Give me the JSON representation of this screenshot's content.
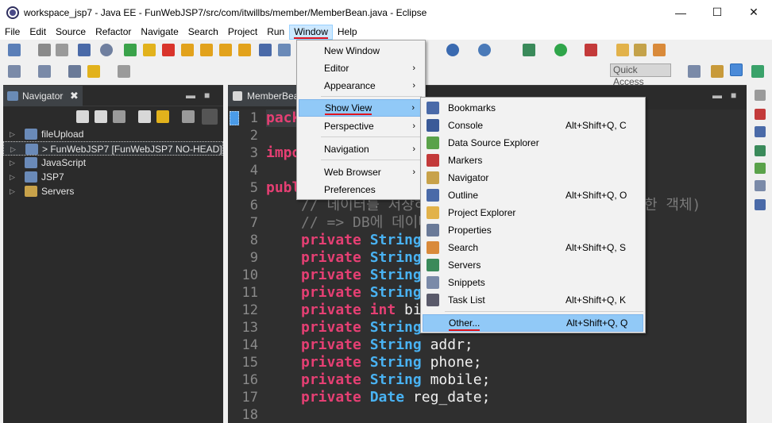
{
  "window": {
    "title": "workspace_jsp7 - Java EE - FunWebJSP7/src/com/itwillbs/member/MemberBean.java - Eclipse",
    "minimize": "—",
    "maximize": "☐",
    "close": "✕"
  },
  "menubar": [
    {
      "label": "File"
    },
    {
      "label": "Edit"
    },
    {
      "label": "Source"
    },
    {
      "label": "Refactor"
    },
    {
      "label": "Navigate"
    },
    {
      "label": "Search"
    },
    {
      "label": "Project"
    },
    {
      "label": "Run"
    },
    {
      "label": "Window"
    },
    {
      "label": "Help"
    }
  ],
  "toolbar": {
    "quick_access_placeholder": "Quick Access"
  },
  "navigator": {
    "tab_label": "Navigator",
    "close": "✖",
    "items": [
      {
        "label": "fileUpload"
      },
      {
        "label": "> FunWebJSP7 [FunWebJSP7 NO-HEAD]"
      },
      {
        "label": "JavaScript"
      },
      {
        "label": "JSP7"
      },
      {
        "label": "Servers"
      }
    ]
  },
  "editor": {
    "tab_label": "MemberBean.java",
    "line_numbers": [
      "1",
      "2",
      "3",
      "4",
      "5",
      "6",
      "7",
      "8",
      "9",
      "10",
      "11",
      "12",
      "13",
      "14",
      "15",
      "16",
      "17",
      "18"
    ],
    "lines": {
      "l1_kw": "pack",
      "l3_kw": "impo",
      "l5_kw": "publ",
      "l6_comment": "// 데이터를 저장하",
      "l6_tail": "한 객체)",
      "l7_comment": "// => DB에 데이터",
      "private": "private",
      "String": "String",
      "int": "int",
      "Date": "Date",
      "l12_id": " bi",
      "l14_id": " addr;",
      "l15_id": " phone;",
      "l16_id": " mobile;",
      "l17_id": " reg_date;"
    }
  },
  "window_menu": {
    "items": [
      {
        "label": "New Window"
      },
      {
        "label": "Editor"
      },
      {
        "label": "Appearance"
      },
      {
        "label": "Show View"
      },
      {
        "label": "Perspective"
      },
      {
        "label": "Navigation"
      },
      {
        "label": "Web Browser"
      },
      {
        "label": "Preferences"
      }
    ],
    "submenu_arrow": "›"
  },
  "show_view_menu": {
    "items": [
      {
        "label": "Bookmarks",
        "shortcut": "",
        "icon": "bookmarks-icon"
      },
      {
        "label": "Console",
        "shortcut": "Alt+Shift+Q, C",
        "icon": "console-icon"
      },
      {
        "label": "Data Source Explorer",
        "shortcut": "",
        "icon": "data-source-icon"
      },
      {
        "label": "Markers",
        "shortcut": "",
        "icon": "markers-icon"
      },
      {
        "label": "Navigator",
        "shortcut": "",
        "icon": "navigator-icon"
      },
      {
        "label": "Outline",
        "shortcut": "Alt+Shift+Q, O",
        "icon": "outline-icon"
      },
      {
        "label": "Project Explorer",
        "shortcut": "",
        "icon": "project-explorer-icon"
      },
      {
        "label": "Properties",
        "shortcut": "",
        "icon": "properties-icon"
      },
      {
        "label": "Search",
        "shortcut": "Alt+Shift+Q, S",
        "icon": "search-icon"
      },
      {
        "label": "Servers",
        "shortcut": "",
        "icon": "servers-icon"
      },
      {
        "label": "Snippets",
        "shortcut": "",
        "icon": "snippets-icon"
      },
      {
        "label": "Task List",
        "shortcut": "Alt+Shift+Q, K",
        "icon": "task-list-icon"
      },
      {
        "label": "Other...",
        "shortcut": "Alt+Shift+Q, Q",
        "icon": ""
      }
    ]
  },
  "colors": {
    "keyword": "#e53f73",
    "type": "#49b2f2",
    "menu_highlight": "#91c9f7",
    "underline_annotation": "#e0141e"
  }
}
